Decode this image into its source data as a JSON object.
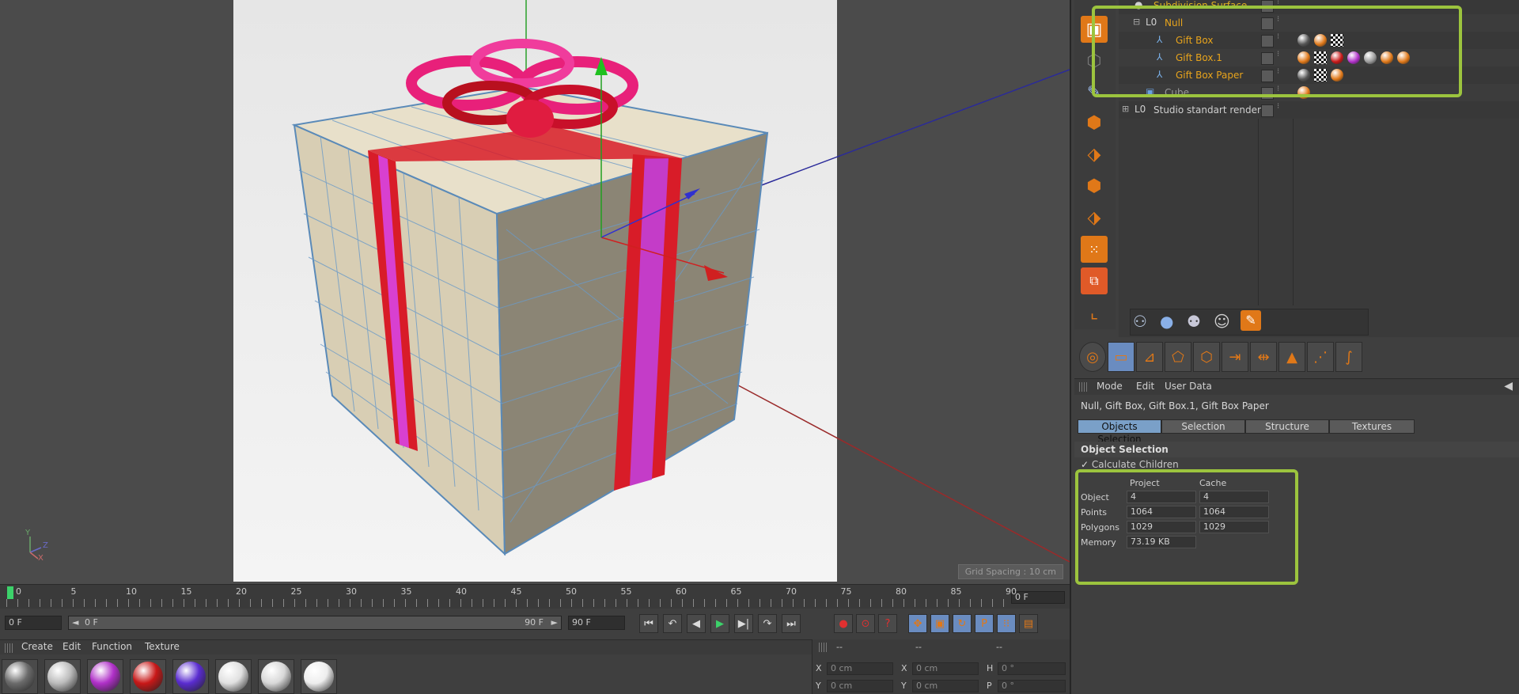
{
  "viewport": {
    "grid_spacing": "Grid Spacing : 10 cm",
    "axis_labels": [
      "Y",
      "Z",
      "X"
    ]
  },
  "timeline": {
    "ticks": [
      "0",
      "5",
      "10",
      "15",
      "20",
      "25",
      "30",
      "35",
      "40",
      "45",
      "50",
      "55",
      "60",
      "65",
      "70",
      "75",
      "80",
      "85",
      "90"
    ],
    "frame_field": "0 F"
  },
  "transport": {
    "start_field": "0 F",
    "range_start": "0 F",
    "range_end": "90 F",
    "end_field": "90 F",
    "range_arrow_left": "◄",
    "range_arrow_right": "►",
    "buttons": [
      "⏮",
      "↶",
      "◀",
      "▶",
      "▶|",
      "↷",
      "⏭"
    ],
    "right_buttons": [
      "●",
      "⊙",
      "?",
      "✥",
      "▣",
      "↻",
      "P",
      "⁝⁝",
      "▤"
    ]
  },
  "materials": {
    "menu": [
      "Create",
      "Edit",
      "Function",
      "Texture"
    ],
    "balls": [
      "#6b6b6b",
      "#bcbcbc",
      "#b030c8",
      "#c81818",
      "#5a2cd0",
      "#e0e0e0",
      "#d8d8d8",
      "#eeeeee"
    ]
  },
  "coordinates": {
    "headers": [
      "--",
      "--",
      "--"
    ],
    "row1": {
      "l1": "X",
      "v1": "0 cm",
      "l2": "X",
      "v2": "0 cm",
      "l3": "H",
      "v3": "0 °"
    },
    "row2": {
      "l1": "Y",
      "v1": "0 cm",
      "l2": "Y",
      "v2": "0 cm",
      "l3": "P",
      "v3": "0 °"
    }
  },
  "object_manager": {
    "items": [
      {
        "name": "Subdivision Surface",
        "indent": 1,
        "color": "#e0b020"
      },
      {
        "name": "Null",
        "indent": 2,
        "color": "#e8a41c"
      },
      {
        "name": "Gift Box",
        "indent": 3,
        "color": "#e8a41c"
      },
      {
        "name": "Gift Box.1",
        "indent": 3,
        "color": "#e8a41c"
      },
      {
        "name": "Gift Box Paper",
        "indent": 3,
        "color": "#e8a41c"
      },
      {
        "name": "Cube",
        "indent": 2,
        "color": "#9a9a9a"
      },
      {
        "name": "Studio standart render",
        "indent": 1,
        "color": "#cfcfcf"
      }
    ],
    "null_icon_label": "L0"
  },
  "attributes": {
    "menu": [
      "Mode",
      "Edit",
      "User Data"
    ],
    "title": "Null, Gift Box, Gift Box.1, Gift Box Paper",
    "tabs": [
      "Objects Selection",
      "Selection",
      "Structure",
      "Textures"
    ],
    "section": "Object Selection",
    "calc_children": "Calculate Children",
    "stats_headers": [
      "Project",
      "Cache"
    ],
    "stats": [
      {
        "label": "Object",
        "project": "4",
        "cache": "4"
      },
      {
        "label": "Points",
        "project": "1064",
        "cache": "1064"
      },
      {
        "label": "Polygons",
        "project": "1029",
        "cache": "1029"
      },
      {
        "label": "Memory",
        "project": "73.19 KB",
        "cache": ""
      }
    ]
  },
  "accent_colors": {
    "highlight": "#9cc43e",
    "orange": "#e07818",
    "tab_active": "#7aa0c8"
  }
}
